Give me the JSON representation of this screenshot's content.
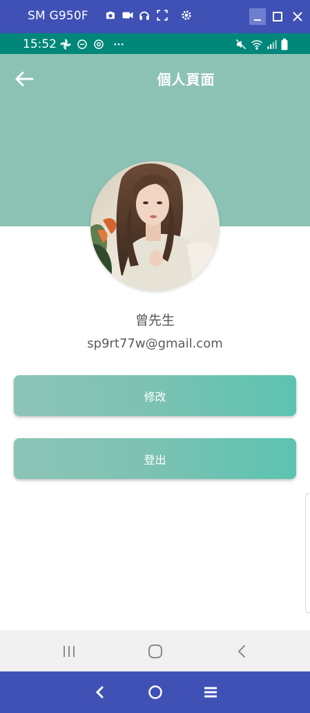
{
  "window": {
    "title": "SM G950F",
    "tools": [
      "camera-icon",
      "video-icon",
      "headphones-icon",
      "fullscreen-icon",
      "settings-icon"
    ],
    "controls": [
      "minimize-icon",
      "maximize-icon",
      "close-icon"
    ]
  },
  "status": {
    "time": "15:52",
    "left_icons": [
      "pinwheel-icon",
      "do-not-disturb-icon",
      "sync-icon",
      "more-icon"
    ],
    "right_icons": [
      "mute-icon",
      "wifi-icon",
      "signal-icon",
      "battery-icon"
    ]
  },
  "header": {
    "title": "個人頁面",
    "background": "#8cc2b4"
  },
  "profile": {
    "name": "曾先生",
    "email": "sp9rt77w@gmail.com"
  },
  "buttons": {
    "edit": "修改",
    "logout": "登出",
    "accent": "#5bc3b0"
  },
  "android_nav": [
    "recents-icon",
    "home-icon",
    "back-icon"
  ],
  "scrcpy_nav": [
    "back-icon",
    "home-icon",
    "menu-icon"
  ]
}
